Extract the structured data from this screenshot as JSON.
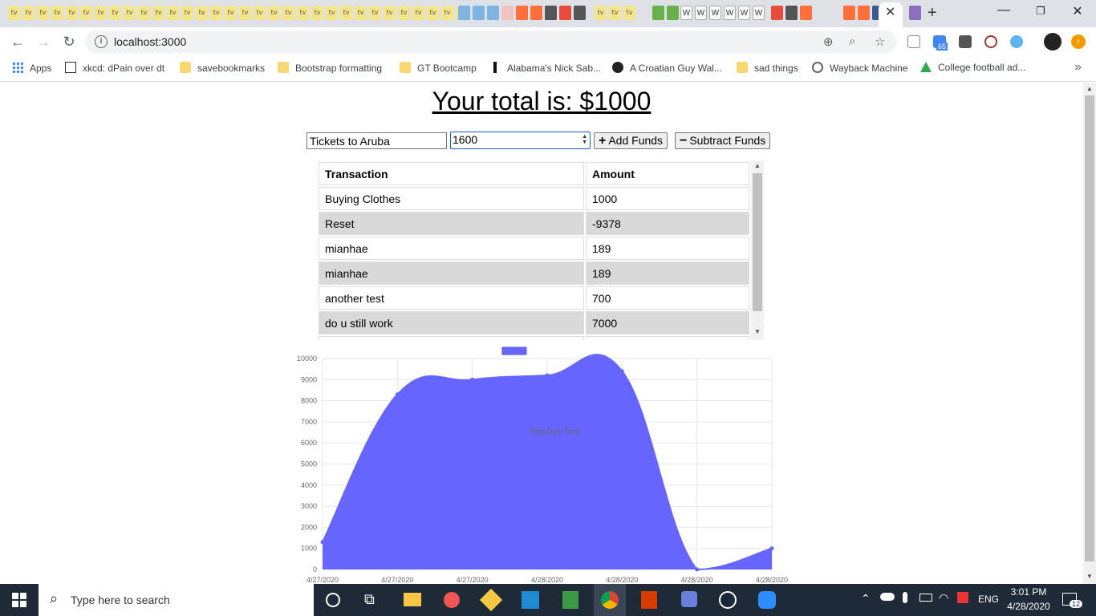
{
  "browser": {
    "tab_icons": [
      "tv",
      "tv",
      "tv",
      "tv",
      "tv",
      "tv",
      "tv",
      "tv",
      "tv",
      "tv",
      "tv",
      "tv",
      "tv",
      "tv",
      "tv",
      "tv",
      "tv",
      "tv",
      "tv",
      "tv",
      "tv",
      "tv",
      "tv",
      "tv",
      "tv",
      "tv",
      "tv",
      "tv",
      "tv",
      "tv",
      "tv",
      "tv",
      "W",
      "W",
      "W",
      "W",
      "W",
      "W",
      "tv",
      "tv",
      "tv"
    ],
    "url": "localhost:3000",
    "extension_badge": "65",
    "bookmarks": [
      {
        "label": "Apps",
        "icon": "apps-grid-icon"
      },
      {
        "label": "xkcd: dPain over dt",
        "icon": "xkcd-icon"
      },
      {
        "label": "savebookmarks",
        "icon": "folder-icon"
      },
      {
        "label": "Bootstrap formatting",
        "icon": "folder-icon"
      },
      {
        "label": "GT Bootcamp",
        "icon": "folder-icon"
      },
      {
        "label": "Alabama's Nick Sab...",
        "icon": "bookmark-icon"
      },
      {
        "label": "A Croatian Guy Wal...",
        "icon": "bookmark-icon"
      },
      {
        "label": "sad things",
        "icon": "folder-icon"
      },
      {
        "label": "Wayback Machine",
        "icon": "globe-icon"
      },
      {
        "label": "College football ad...",
        "icon": "drive-icon"
      }
    ]
  },
  "page": {
    "total_text": "Your total is: $1000",
    "name_input_value": "Tickets to Aruba",
    "amount_input_value": "1600",
    "add_button_label": "Add Funds",
    "subtract_button_label": "Subtract Funds",
    "table": {
      "headers": [
        "Transaction",
        "Amount"
      ],
      "rows": [
        [
          "Buying Clothes",
          "1000"
        ],
        [
          "Reset",
          "-9378"
        ],
        [
          "mianhae",
          "189"
        ],
        [
          "mianhae",
          "189"
        ],
        [
          "another test",
          "700"
        ],
        [
          "do u still work",
          "7000"
        ]
      ]
    }
  },
  "chart_data": {
    "type": "area",
    "legend": "Total Over Time",
    "legend_position": "top",
    "color": "#6666ff",
    "x": [
      "4/27/2020",
      "4/27/2020",
      "4/27/2020",
      "4/28/2020",
      "4/28/2020",
      "4/28/2020",
      "4/28/2020"
    ],
    "y": [
      1300,
      8300,
      9000,
      9200,
      9400,
      0,
      1000
    ],
    "ylim": [
      0,
      10000
    ],
    "yticks": [
      "10000",
      "9000",
      "8000",
      "7000",
      "6000",
      "5000",
      "4000",
      "3000",
      "2000",
      "1000",
      "0"
    ],
    "grid": true
  },
  "taskbar": {
    "search_placeholder": "Type here to search",
    "language": "ENG",
    "time": "3:01 PM",
    "date": "4/28/2020",
    "notification_count": "12"
  }
}
